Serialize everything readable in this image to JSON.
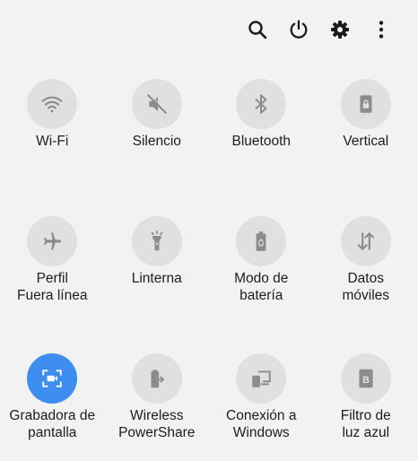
{
  "header": {
    "icons": [
      "search-icon",
      "power-icon",
      "gear-icon",
      "more-vert-icon"
    ]
  },
  "colors": {
    "background": "#f2f2f2",
    "tile_off": "#e0e0e0",
    "icon_off": "#8c8c8c",
    "tile_on": "#3e8ef1",
    "icon_on": "#ffffff"
  },
  "tiles": [
    {
      "label": "Wi-Fi",
      "icon": "wifi-icon",
      "active": false
    },
    {
      "label": "Silencio",
      "icon": "mute-icon",
      "active": false
    },
    {
      "label": "Bluetooth",
      "icon": "bluetooth-icon",
      "active": false
    },
    {
      "label": "Vertical",
      "icon": "rotation-lock-icon",
      "active": false
    },
    {
      "label": "Perfil\nFuera línea",
      "icon": "airplane-icon",
      "active": false
    },
    {
      "label": "Linterna",
      "icon": "flashlight-icon",
      "active": false
    },
    {
      "label": "Modo de\nbatería",
      "icon": "battery-saver-icon",
      "active": false
    },
    {
      "label": "Datos\nmóviles",
      "icon": "mobile-data-icon",
      "active": false
    },
    {
      "label": "Grabadora de\npantalla",
      "icon": "screen-recorder-icon",
      "active": true
    },
    {
      "label": "Wireless\nPowerShare",
      "icon": "wireless-powershare-icon",
      "active": false
    },
    {
      "label": "Conexión a\nWindows",
      "icon": "link-to-windows-icon",
      "active": false
    },
    {
      "label": "Filtro de\nluz azul",
      "icon": "blue-light-filter-icon",
      "active": false
    }
  ]
}
